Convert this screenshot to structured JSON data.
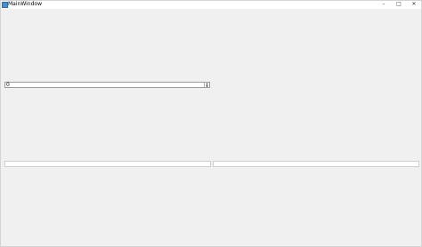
{
  "window": {
    "title": "MainWindow",
    "minimize_glyph": "–",
    "maximize_glyph": "□",
    "close_glyph": "✕"
  },
  "spinbox": {
    "value": "0",
    "up_glyph": "▲",
    "down_glyph": "▼"
  },
  "fields": {
    "left_value": "",
    "right_value": ""
  },
  "icons": {
    "app": "app-icon"
  }
}
